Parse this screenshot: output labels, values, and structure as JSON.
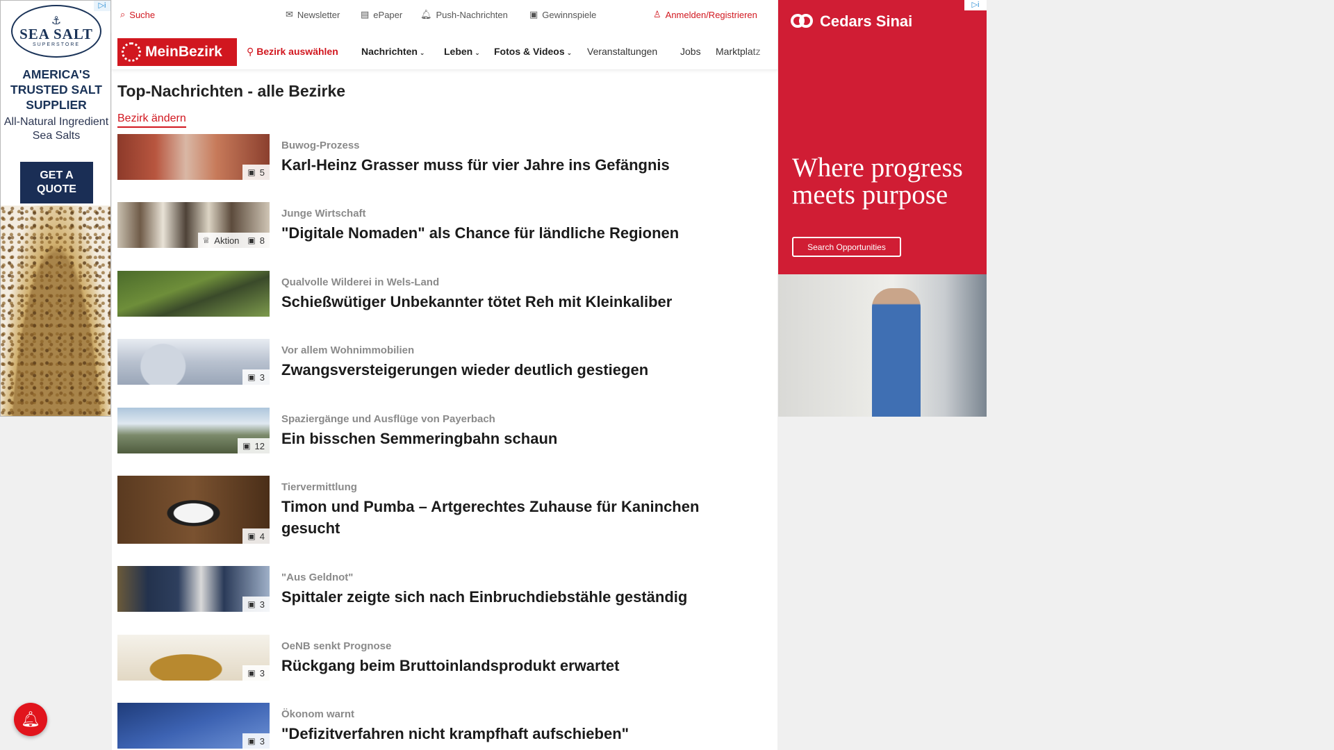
{
  "left_ad": {
    "ad_choices": "▷i",
    "logo_brand": "SEA SALT",
    "logo_sub": "SUPERSTORE",
    "headline": "AMERICA'S TRUSTED SALT SUPPLIER",
    "subline": "All-Natural Ingredient Sea Salts",
    "cta": "GET A QUOTE"
  },
  "topbar": {
    "search": "Suche",
    "newsletter": "Newsletter",
    "epaper": "ePaper",
    "push": "Push-Nachrichten",
    "games": "Gewinnspiele",
    "login": "Anmelden/Registrieren"
  },
  "nav": {
    "logo": "MeinBezirk",
    "select_district": "Bezirk auswählen",
    "items": [
      {
        "label": "Nachrichten"
      },
      {
        "label": "Leben"
      },
      {
        "label": "Fotos & Videos"
      },
      {
        "label": "Veranstaltungen"
      },
      {
        "label": "Jobs"
      },
      {
        "label": "Marktplatz"
      }
    ]
  },
  "main": {
    "title": "Top-Nachrichten - alle Bezirke",
    "change_district": "Bezirk ändern",
    "articles": [
      {
        "kicker": "Buwog-Prozess",
        "headline": "Karl-Heinz Grasser muss für vier Jahre ins Gefängnis",
        "photos": "5",
        "award": ""
      },
      {
        "kicker": "Junge Wirtschaft",
        "headline": "\"Digitale Nomaden\" als Chance für ländliche Regionen",
        "photos": "8",
        "award": "Aktion"
      },
      {
        "kicker": "Qualvolle Wilderei in Wels-Land",
        "headline": "Schießwütiger Unbekannter tötet Reh mit Kleinkaliber",
        "photos": "",
        "award": ""
      },
      {
        "kicker": "Vor allem Wohnimmobilien",
        "headline": "Zwangsversteigerungen wieder deutlich gestiegen",
        "photos": "3",
        "award": ""
      },
      {
        "kicker": "Spaziergänge und Ausflüge von Payerbach",
        "headline": "Ein bisschen Semmeringbahn schaun",
        "photos": "12",
        "award": ""
      },
      {
        "kicker": "Tiervermittlung",
        "headline": "Timon und Pumba – Artgerechtes Zuhause für Kaninchen gesucht",
        "photos": "4",
        "award": ""
      },
      {
        "kicker": "\"Aus Geldnot\"",
        "headline": "Spittaler zeigte sich nach Einbruchdiebstähle geständig",
        "photos": "3",
        "award": ""
      },
      {
        "kicker": "OeNB senkt Prognose",
        "headline": "Rückgang beim Bruttoinlandsprodukt erwartet",
        "photos": "3",
        "award": ""
      },
      {
        "kicker": "Ökonom warnt",
        "headline": "\"Defizitverfahren nicht krampfhaft aufschieben\"",
        "photos": "3",
        "award": ""
      }
    ]
  },
  "right_ad": {
    "ad_choices": "▷i",
    "brand": "Cedars Sinai",
    "headline": "Where progress meets purpose",
    "cta": "Search Opportunities"
  },
  "colors": {
    "brand_red": "#d1171f",
    "ad_red": "#d01d34",
    "navy": "#1a2e55"
  },
  "icons": [
    "search-icon",
    "mail-icon",
    "newspaper-icon",
    "bell-icon",
    "gift-icon",
    "user-icon",
    "location-pin-icon",
    "chevron-down-icon",
    "camera-icon",
    "trophy-icon"
  ]
}
